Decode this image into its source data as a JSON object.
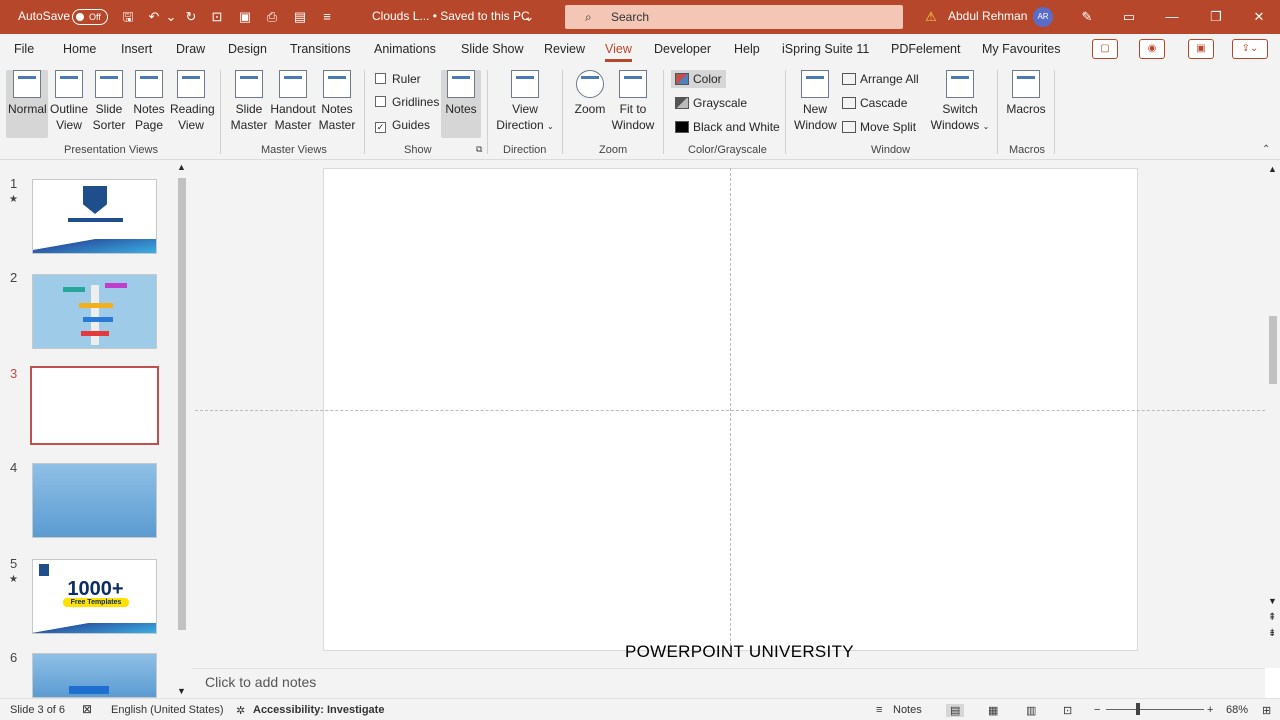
{
  "titlebar": {
    "autosave_label": "AutoSave",
    "autosave_state": "Off",
    "doc_title": "Clouds L... • Saved to this PC",
    "search_placeholder": "Search",
    "user_name": "Abdul Rehman",
    "user_initials": "AR"
  },
  "tabs": [
    "File",
    "Home",
    "Insert",
    "Draw",
    "Design",
    "Transitions",
    "Animations",
    "Slide Show",
    "Review",
    "View",
    "Developer",
    "Help",
    "iSpring Suite 11",
    "PDFelement",
    "My Favourites"
  ],
  "active_tab": "View",
  "ribbon": {
    "presentation_views": {
      "label": "Presentation Views",
      "buttons": [
        {
          "l1": "Normal",
          "l2": ""
        },
        {
          "l1": "Outline",
          "l2": "View"
        },
        {
          "l1": "Slide",
          "l2": "Sorter"
        },
        {
          "l1": "Notes",
          "l2": "Page"
        },
        {
          "l1": "Reading",
          "l2": "View"
        }
      ]
    },
    "master_views": {
      "label": "Master Views",
      "buttons": [
        {
          "l1": "Slide",
          "l2": "Master"
        },
        {
          "l1": "Handout",
          "l2": "Master"
        },
        {
          "l1": "Notes",
          "l2": "Master"
        }
      ]
    },
    "show": {
      "label": "Show",
      "ruler": "Ruler",
      "gridlines": "Gridlines",
      "guides": "Guides",
      "notes": "Notes",
      "ruler_checked": false,
      "gridlines_checked": false,
      "guides_checked": true
    },
    "direction": {
      "label": "Direction",
      "l1": "View",
      "l2": "Direction"
    },
    "zoom": {
      "label": "Zoom",
      "zoom": "Zoom",
      "fit1": "Fit to",
      "fit2": "Window"
    },
    "color": {
      "label": "Color/Grayscale",
      "color": "Color",
      "grayscale": "Grayscale",
      "bw": "Black and White"
    },
    "window": {
      "label": "Window",
      "new1": "New",
      "new2": "Window",
      "arrange": "Arrange All",
      "cascade": "Cascade",
      "split": "Move Split",
      "switch1": "Switch",
      "switch2": "Windows"
    },
    "macros": {
      "label": "Macros",
      "button": "Macros"
    }
  },
  "slides": [
    {
      "num": "1",
      "star": true,
      "thumb": "1000+ free templates title"
    },
    {
      "num": "2",
      "star": false,
      "thumb": "diagram"
    },
    {
      "num": "3",
      "star": false,
      "thumb": "blank"
    },
    {
      "num": "4",
      "star": false,
      "thumb": "blue gradient"
    },
    {
      "num": "5",
      "star": true,
      "thumb": "1000+ Free Templates"
    },
    {
      "num": "6",
      "star": false,
      "thumb": "blue gradient"
    }
  ],
  "thumb5": {
    "big": "1000+",
    "small": "Free Templates"
  },
  "slide": {
    "footer": "POWERPOINT UNIVERSITY"
  },
  "notes_placeholder": "Click to add notes",
  "status": {
    "slide": "Slide 3 of 6",
    "language": "English (United States)",
    "accessibility": "Accessibility: Investigate",
    "notes": "Notes",
    "zoom": "68%"
  },
  "colors": {
    "accent": "#b7472a",
    "selected_slide": "#c0504d"
  }
}
